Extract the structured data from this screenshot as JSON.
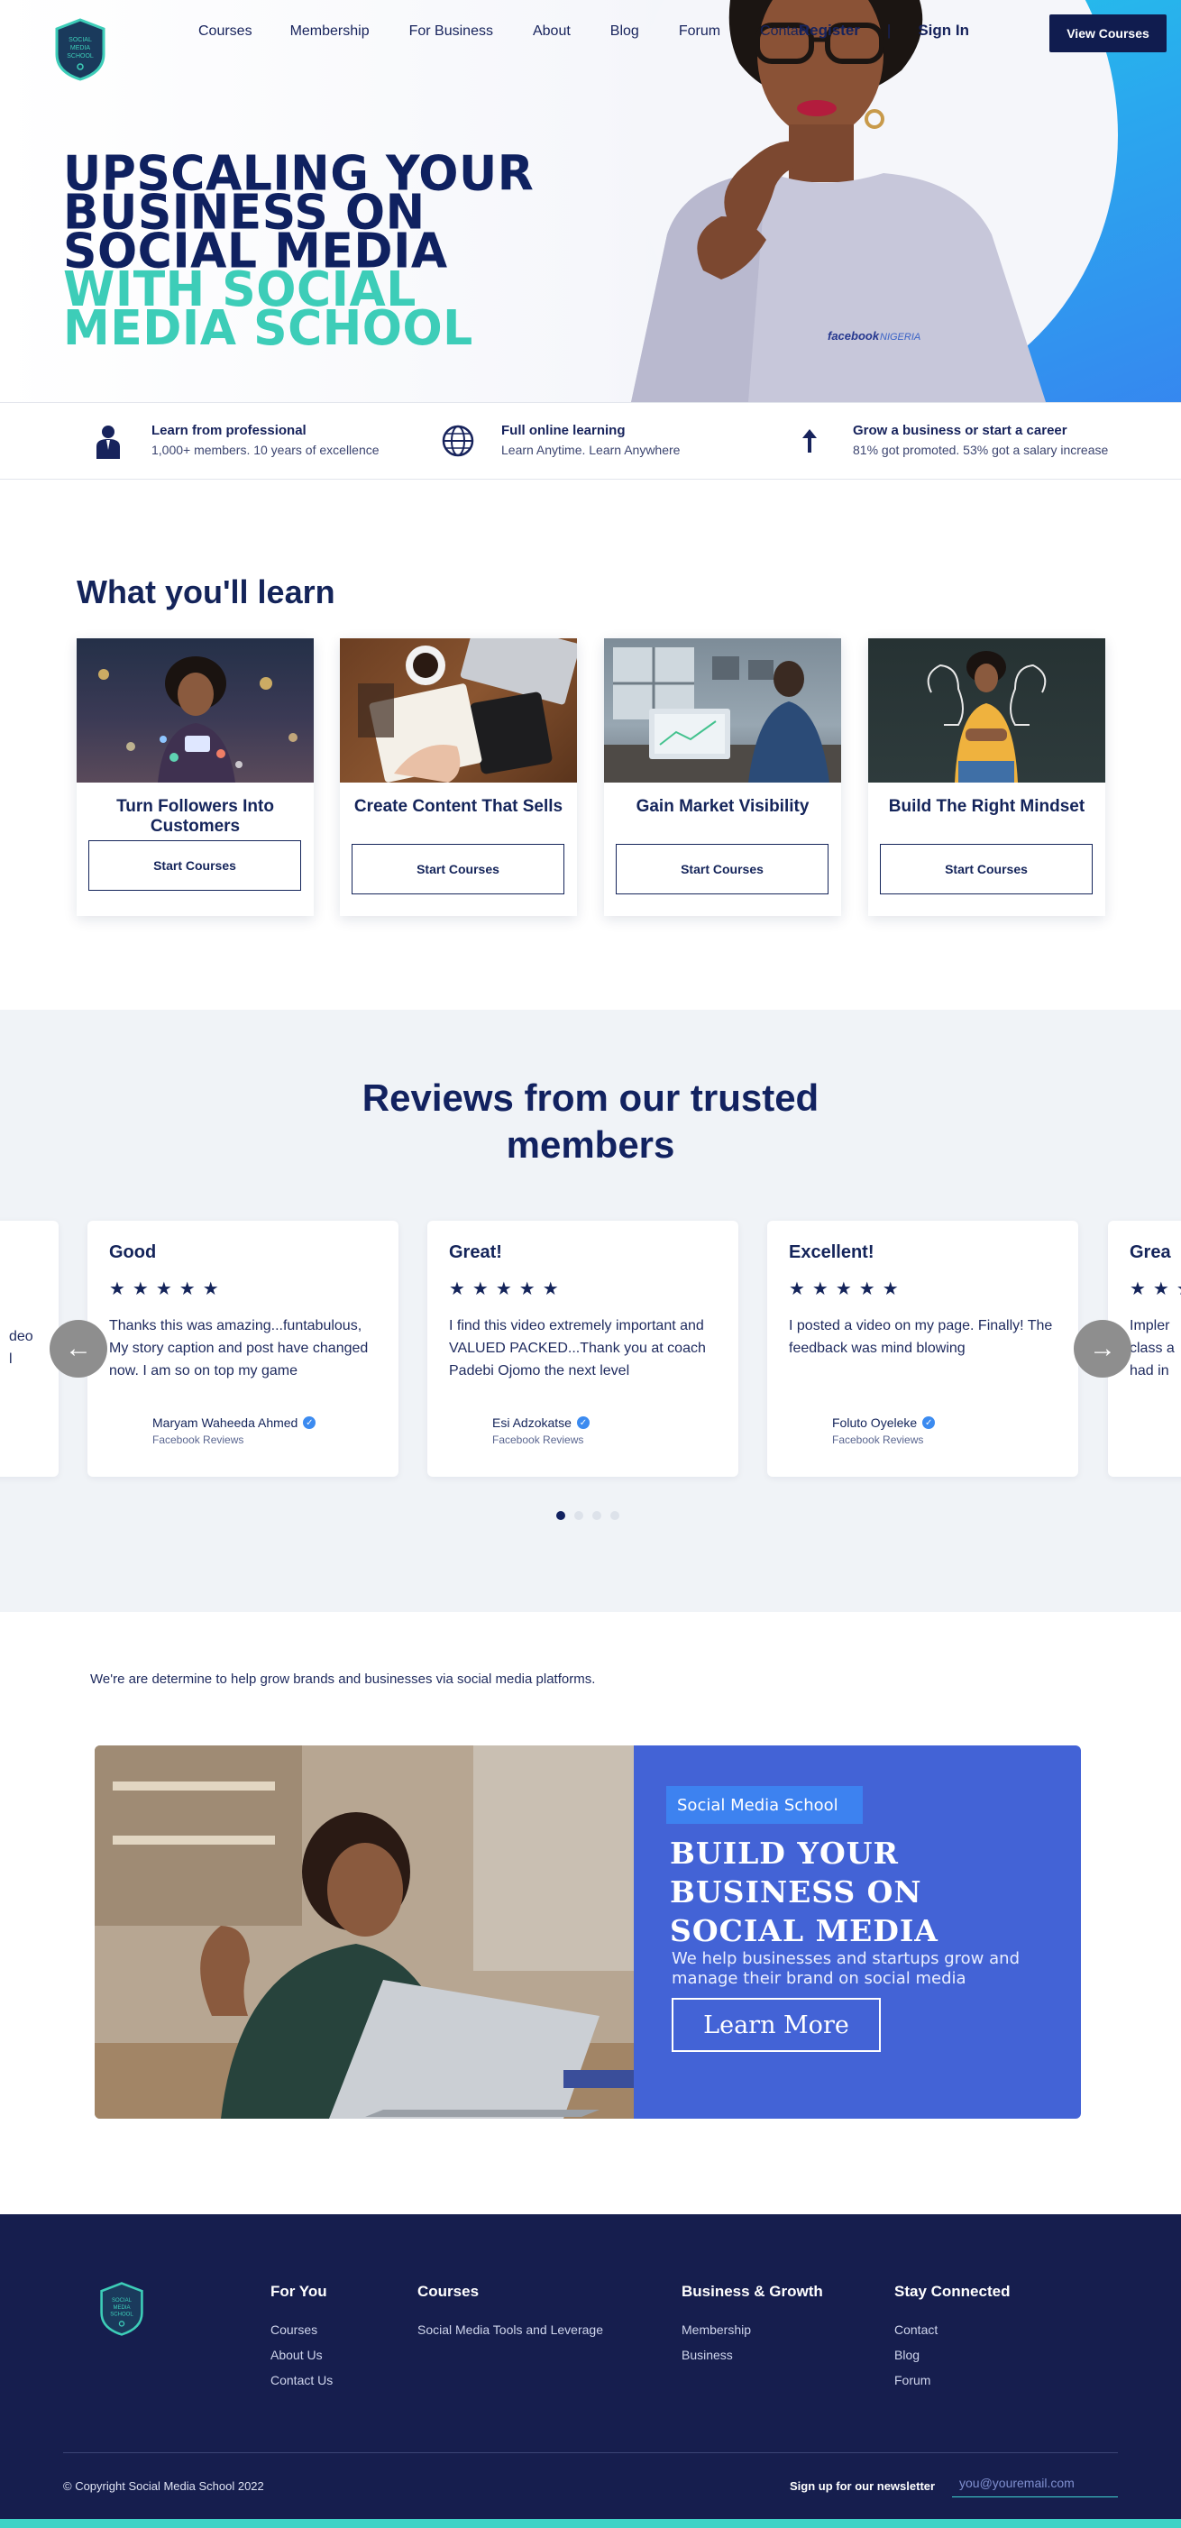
{
  "brand": {
    "logo_text": [
      "SOCIAL",
      "MEDIA",
      "SCHOOL"
    ],
    "navy": "#14245a",
    "teal": "#3dcdb8",
    "promo_blue": "#4363d6",
    "footer_bg": "#161e4e"
  },
  "nav": {
    "items": [
      "Courses",
      "Membership",
      "For Business",
      "About",
      "Blog",
      "Forum",
      "Contact"
    ],
    "register": "Register",
    "separator": "|",
    "sign_in": "Sign In",
    "cta": "View Courses"
  },
  "hero": {
    "lines_dark": [
      "UPSCALING YOUR",
      "BUSINESS ON",
      "SOCIAL MEDIA"
    ],
    "lines_teal": [
      "WITH SOCIAL",
      "MEDIA SCHOOL"
    ],
    "shirt_text": "facebook",
    "shirt_text_2": "NIGERIA"
  },
  "features": [
    {
      "icon": "person-icon",
      "title": "Learn from professional",
      "sub": "1,000+ members. 10 years of excellence"
    },
    {
      "icon": "globe-icon",
      "title": "Full online learning",
      "sub": "Learn Anytime. Learn Anywhere"
    },
    {
      "icon": "arrow-up-icon",
      "title": "Grow a business or start a career",
      "sub": "81% got promoted. 53% got a salary increase"
    }
  ],
  "learn": {
    "title": "What you'll learn",
    "cards": [
      {
        "title": "Turn Followers Into Customers",
        "button": "Start Courses"
      },
      {
        "title": "Create Content That Sells",
        "button": "Start Courses"
      },
      {
        "title": "Gain Market Visibility",
        "button": "Start Courses"
      },
      {
        "title": "Build The Right Mindset",
        "button": "Start Courses"
      }
    ]
  },
  "reviews": {
    "title_1": "Reviews from our trusted",
    "title_2": "members",
    "stars": "★★★★★",
    "left_partial": [
      "deo",
      "l"
    ],
    "items": [
      {
        "title": "Good",
        "body": "Thanks this was amazing...funtabulous, My story caption and post have changed now. I am so on top my game",
        "name": "Maryam Waheeda Ahmed",
        "source": "Facebook Reviews"
      },
      {
        "title": "Great!",
        "body": "I find this video extremely important and VALUED PACKED...Thank you at coach Padebi Ojomo the next level",
        "name": "Esi Adzokatse",
        "source": "Facebook Reviews"
      },
      {
        "title": "Excellent!",
        "body": "I posted a video on my page. Finally! The feedback was mind blowing",
        "name": "Foluto Oyeleke",
        "source": "Facebook Reviews"
      },
      {
        "title": "Grea",
        "body_lines": [
          "Impler",
          "class a",
          "had in"
        ]
      }
    ],
    "prev_icon": "←",
    "next_icon": "→",
    "dots": 4,
    "active_dot": 0
  },
  "tagline": "We're are determine to help grow brands and businesses via social media platforms.",
  "promo": {
    "chip": "Social Media School",
    "title": [
      "BUILD YOUR",
      "BUSINESS ON",
      "SOCIAL MEDIA"
    ],
    "sub": "We help businesses and startups grow and manage their brand on social media",
    "button": "Learn More"
  },
  "footer": {
    "cols": [
      {
        "title": "For You",
        "links": [
          "Courses",
          "About Us",
          "Contact Us"
        ]
      },
      {
        "title": "Courses",
        "links": [
          "Social Media Tools and Leverage"
        ]
      },
      {
        "title": "Business & Growth",
        "links": [
          "Membership",
          "Business"
        ]
      },
      {
        "title": "Stay Connected",
        "links": [
          "Contact",
          "Blog",
          "Forum"
        ]
      }
    ],
    "copyright": "© Copyright Social Media School 2022",
    "newsletter": "Sign up for our newsletter",
    "email_placeholder": "you@youremail.com"
  }
}
